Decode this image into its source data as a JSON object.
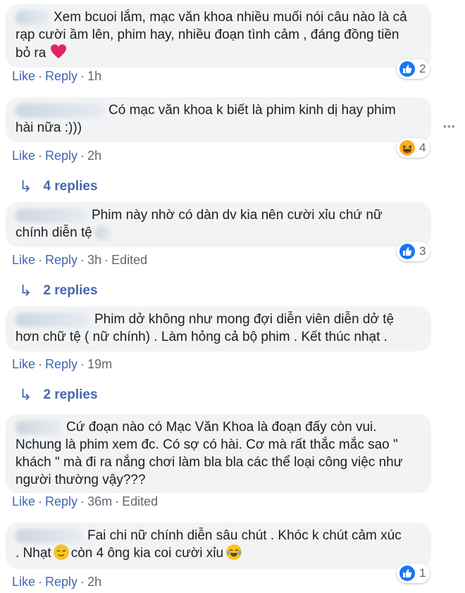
{
  "comments": [
    {
      "text": "Xem bcuoi lắm, mạc văn khoa nhiều muối nói câu nào là cả rạp cười ầm lên, phim hay, nhiều đoạn tình cảm , đáng đồng tiền bỏ ra",
      "lines": [
        "Xem bcuoi lắm, mạc văn khoa nhiều muối nói câu nào là cả",
        "rạp cười ầm lên, phim hay, nhiều đoạn tình cảm , đáng đồng tiền",
        "bỏ ra"
      ],
      "emoji": "heart-icon",
      "like": "Like",
      "reply": "Reply",
      "time": "1h",
      "edited": "",
      "reaction_type": "like-icon",
      "reaction_count": "2"
    },
    {
      "lines": [
        "Có mạc văn khoa k biết là phim kinh dị hay phim",
        "hài nữa :)))"
      ],
      "like": "Like",
      "reply": "Reply",
      "time": "2h",
      "edited": "",
      "reaction_type": "haha-icon",
      "reaction_count": "4",
      "replies": "4 replies"
    },
    {
      "lines": [
        "Phim này nhờ có dàn dv kia nên cười xỉu chứ nữ",
        "chính diễn tệ"
      ],
      "like": "Like",
      "reply": "Reply",
      "time": "3h",
      "edited": "Edited",
      "reaction_type": "like-icon",
      "reaction_count": "3",
      "replies": "2 replies"
    },
    {
      "lines": [
        "Phim dở không như mong đợi diễn viên diễn dở tệ",
        "hơn chữ tệ ( nữ chính) . Làm hỏng cả bộ phim . Kết thúc nhạt ."
      ],
      "like": "Like",
      "reply": "Reply",
      "time": "19m",
      "edited": "",
      "replies": "2 replies"
    },
    {
      "lines": [
        "Cứ đoạn nào có Mạc Văn Khoa là đoạn đấy còn vui.",
        "Nchung là phim xem đc. Có sợ có hài. Cơ mà rất thắc mắc sao \"",
        "khách \" mà đi ra nắng chơi làm bla bla các thể loại công việc như",
        "người thường vậy???"
      ],
      "like": "Like",
      "reply": "Reply",
      "time": "36m",
      "edited": "Edited"
    },
    {
      "lines": [
        "Fai chi nữ chính diễn sâu chút . Khóc k chút cảm xúc",
        ". Nhạt",
        "còn 4 ông kia coi cười xỉu"
      ],
      "like": "Like",
      "reply": "Reply",
      "time": "2h",
      "edited": "",
      "reaction_type": "like-icon",
      "reaction_count": "1"
    }
  ],
  "separator": "·",
  "colors": {
    "link": "#4267b2",
    "bubble": "#f2f3f5",
    "meta": "#606770",
    "like": "#1877f2",
    "haha": "#f7b125"
  }
}
